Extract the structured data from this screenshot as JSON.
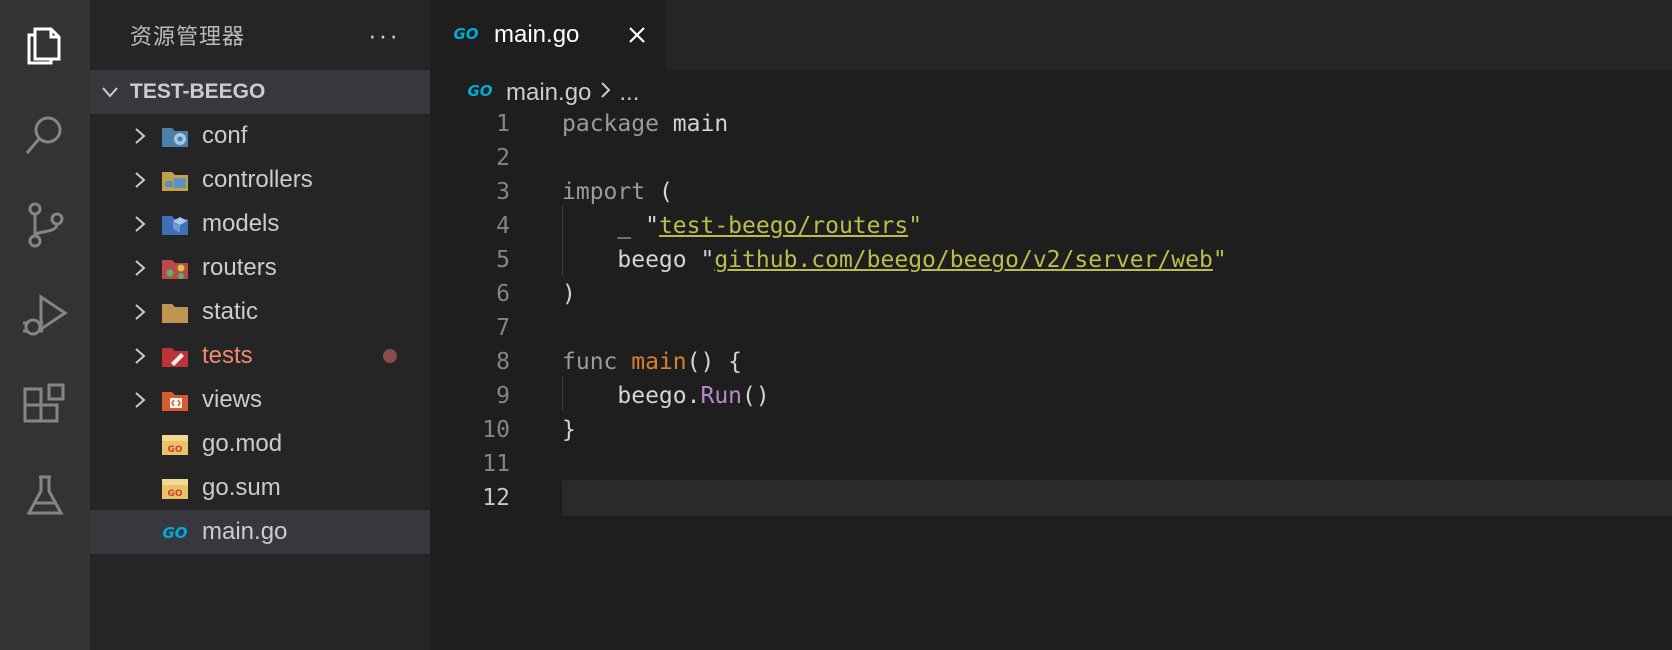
{
  "activity_bar": {
    "items": [
      {
        "name": "explorer-icon"
      },
      {
        "name": "search-icon"
      },
      {
        "name": "source-control-icon"
      },
      {
        "name": "run-debug-icon"
      },
      {
        "name": "extensions-icon"
      },
      {
        "name": "testing-icon"
      }
    ]
  },
  "sidebar": {
    "title": "资源管理器",
    "more": "···",
    "folder": "TEST-BEEGO",
    "items": [
      {
        "label": "conf",
        "type": "folder"
      },
      {
        "label": "controllers",
        "type": "folder"
      },
      {
        "label": "models",
        "type": "folder"
      },
      {
        "label": "routers",
        "type": "folder"
      },
      {
        "label": "static",
        "type": "folder"
      },
      {
        "label": "tests",
        "type": "folder",
        "modified": true
      },
      {
        "label": "views",
        "type": "folder"
      },
      {
        "label": "go.mod",
        "type": "file"
      },
      {
        "label": "go.sum",
        "type": "file"
      },
      {
        "label": "main.go",
        "type": "file",
        "selected": true
      }
    ]
  },
  "tabs": [
    {
      "label": "main.go",
      "lang_badge": "GO"
    }
  ],
  "breadcrumb": {
    "file": "main.go",
    "badge": "GO",
    "more": "..."
  },
  "editor": {
    "line_numbers": [
      "1",
      "2",
      "3",
      "4",
      "5",
      "6",
      "7",
      "8",
      "9",
      "10",
      "11",
      "12"
    ],
    "tokens": {
      "l1_kw": "package",
      "l1_rest": " main",
      "l3_kw": "import",
      "l3_rest": " (",
      "l4_pre": "    _ \"",
      "l4_str": "test-beego/routers",
      "l4_post": "\"",
      "l5_pre": "    beego \"",
      "l5_str": "github.com/beego/beego/v2/server/web",
      "l5_post": "\"",
      "l6": ")",
      "l8_kw": "func",
      "l8_fn": "main",
      "l8_rest": "() {",
      "l9_pre": "    beego.",
      "l9_meth": "Run",
      "l9_post": "()",
      "l10": "}"
    }
  },
  "colors": {
    "accent_go": "#00acd7",
    "modified": "#f48771"
  }
}
